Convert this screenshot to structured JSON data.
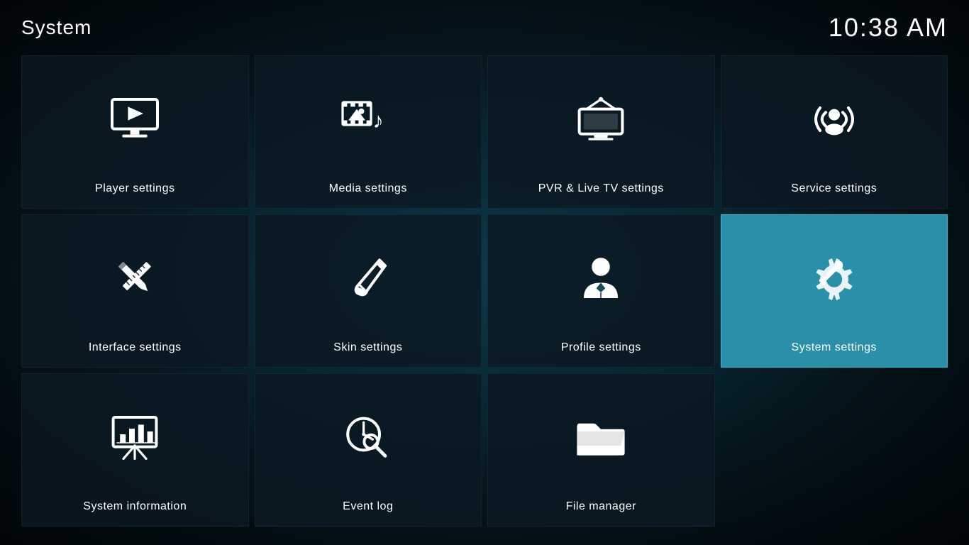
{
  "header": {
    "title": "System",
    "clock": "10:38 AM"
  },
  "grid": {
    "items": [
      {
        "id": "player-settings",
        "label": "Player settings",
        "icon": "player",
        "active": false
      },
      {
        "id": "media-settings",
        "label": "Media settings",
        "icon": "media",
        "active": false
      },
      {
        "id": "pvr-settings",
        "label": "PVR & Live TV settings",
        "icon": "pvr",
        "active": false
      },
      {
        "id": "service-settings",
        "label": "Service settings",
        "icon": "service",
        "active": false
      },
      {
        "id": "interface-settings",
        "label": "Interface settings",
        "icon": "interface",
        "active": false
      },
      {
        "id": "skin-settings",
        "label": "Skin settings",
        "icon": "skin",
        "active": false
      },
      {
        "id": "profile-settings",
        "label": "Profile settings",
        "icon": "profile",
        "active": false
      },
      {
        "id": "system-settings",
        "label": "System settings",
        "icon": "system",
        "active": true
      },
      {
        "id": "system-information",
        "label": "System information",
        "icon": "sysinfo",
        "active": false
      },
      {
        "id": "event-log",
        "label": "Event log",
        "icon": "eventlog",
        "active": false
      },
      {
        "id": "file-manager",
        "label": "File manager",
        "icon": "filemanager",
        "active": false
      },
      {
        "id": "empty",
        "label": "",
        "icon": "none",
        "active": false
      }
    ]
  }
}
